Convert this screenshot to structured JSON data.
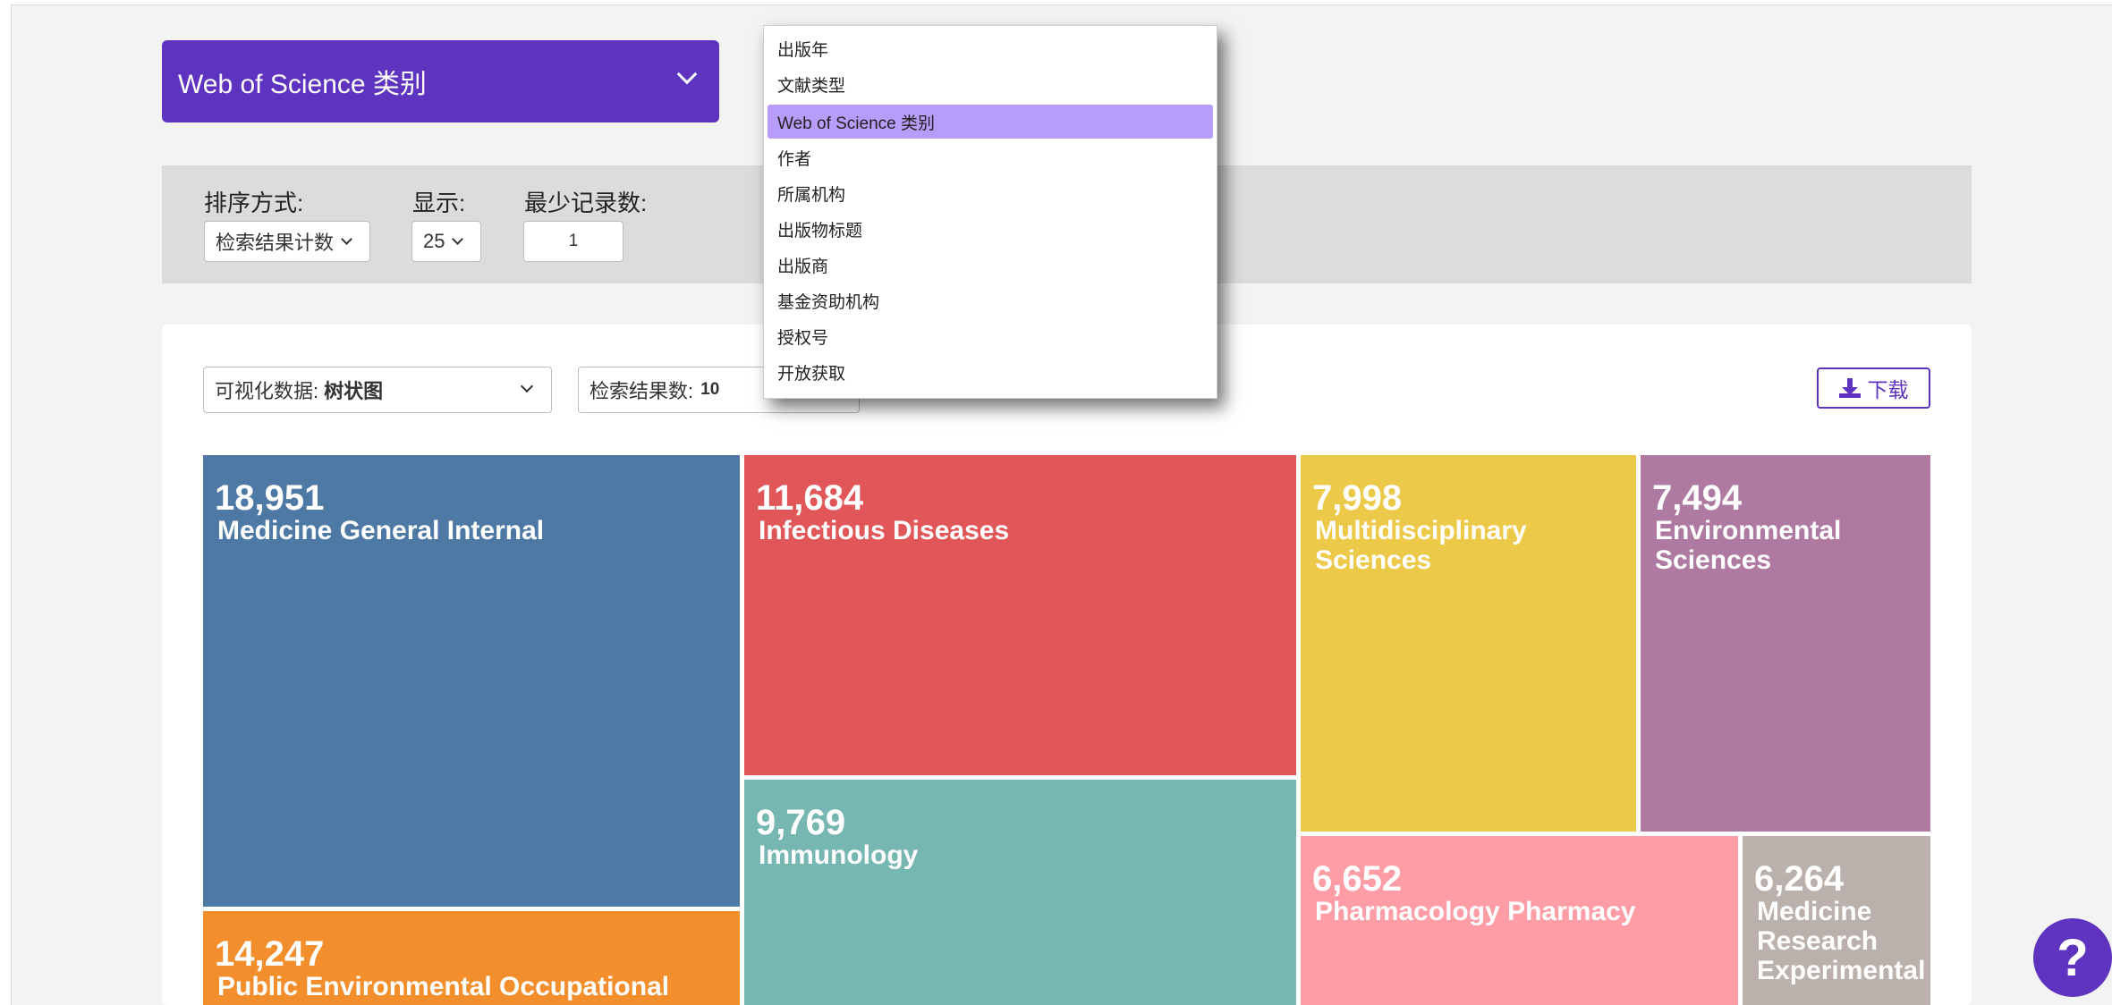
{
  "field_select": {
    "label": "Web of Science 类别"
  },
  "options": {
    "sort_label": "排序方式:",
    "sort_value": "检索结果计数",
    "show_label": "显示:",
    "show_value": "25",
    "min_label": "最少记录数:",
    "min_value": "1"
  },
  "viz": {
    "select_prefix": "可视化数据:",
    "select_value": "树状图",
    "count_prefix": "检索结果数:",
    "count_value": "10",
    "download_label": "下载"
  },
  "dropdown": {
    "items": [
      "出版年",
      "文献类型",
      "Web of Science 类别",
      "作者",
      "所属机构",
      "出版物标题",
      "出版商",
      "基金资助机构",
      "授权号",
      "开放获取"
    ],
    "selected_index": 2
  },
  "chart_data": {
    "type": "treemap",
    "items": [
      {
        "label": "Medicine General Internal",
        "value": 18951,
        "display": "18,951",
        "color": "#4e79a5"
      },
      {
        "label": "Public Environmental Occupational",
        "value": 14247,
        "display": "14,247",
        "color": "#f28e2b"
      },
      {
        "label": "Infectious Diseases",
        "value": 11684,
        "display": "11,684",
        "color": "#e15759"
      },
      {
        "label": "Immunology",
        "value": 9769,
        "display": "9,769",
        "color": "#76b7b2"
      },
      {
        "label": "Multidisciplinary Sciences",
        "value": 7998,
        "display": "7,998",
        "color": "#edc949"
      },
      {
        "label": "Environmental Sciences",
        "value": 7494,
        "display": "7,494",
        "color": "#af7aa1"
      },
      {
        "label": "Pharmacology Pharmacy",
        "value": 6652,
        "display": "6,652",
        "color": "#ff9da7"
      },
      {
        "label": "Medicine Research Experimental",
        "value": 6264,
        "display": "6,264",
        "color": "#bab0ac"
      }
    ]
  },
  "help": {
    "label": "?"
  }
}
